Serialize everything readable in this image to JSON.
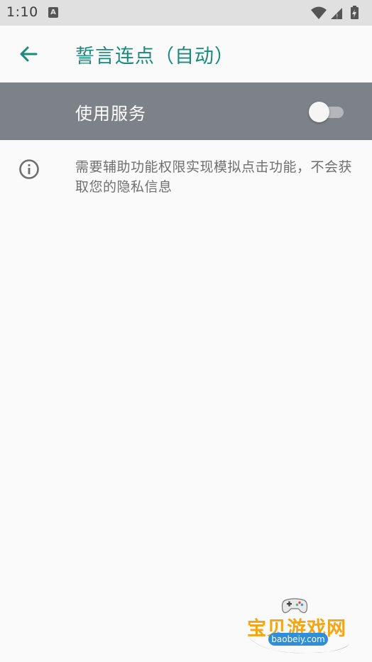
{
  "status_bar": {
    "time": "1:10",
    "notification_icon": "a-notification-icon",
    "icons": [
      "wifi-icon",
      "signal-icon",
      "battery-charging-icon"
    ]
  },
  "app_bar": {
    "back_icon": "arrow-left-icon",
    "title": "誓言连点（自动）",
    "accent_color": "#1a8a7c"
  },
  "service": {
    "label": "使用服务",
    "enabled": false,
    "row_color": "#7d8288"
  },
  "info": {
    "icon": "info-icon",
    "text": "需要辅助功能权限实现模拟点击功能，不会获取您的隐私信息"
  },
  "watermark": {
    "brand": "宝贝游戏网",
    "site": "baobeiy.com",
    "icon": "gamepad-icon"
  }
}
